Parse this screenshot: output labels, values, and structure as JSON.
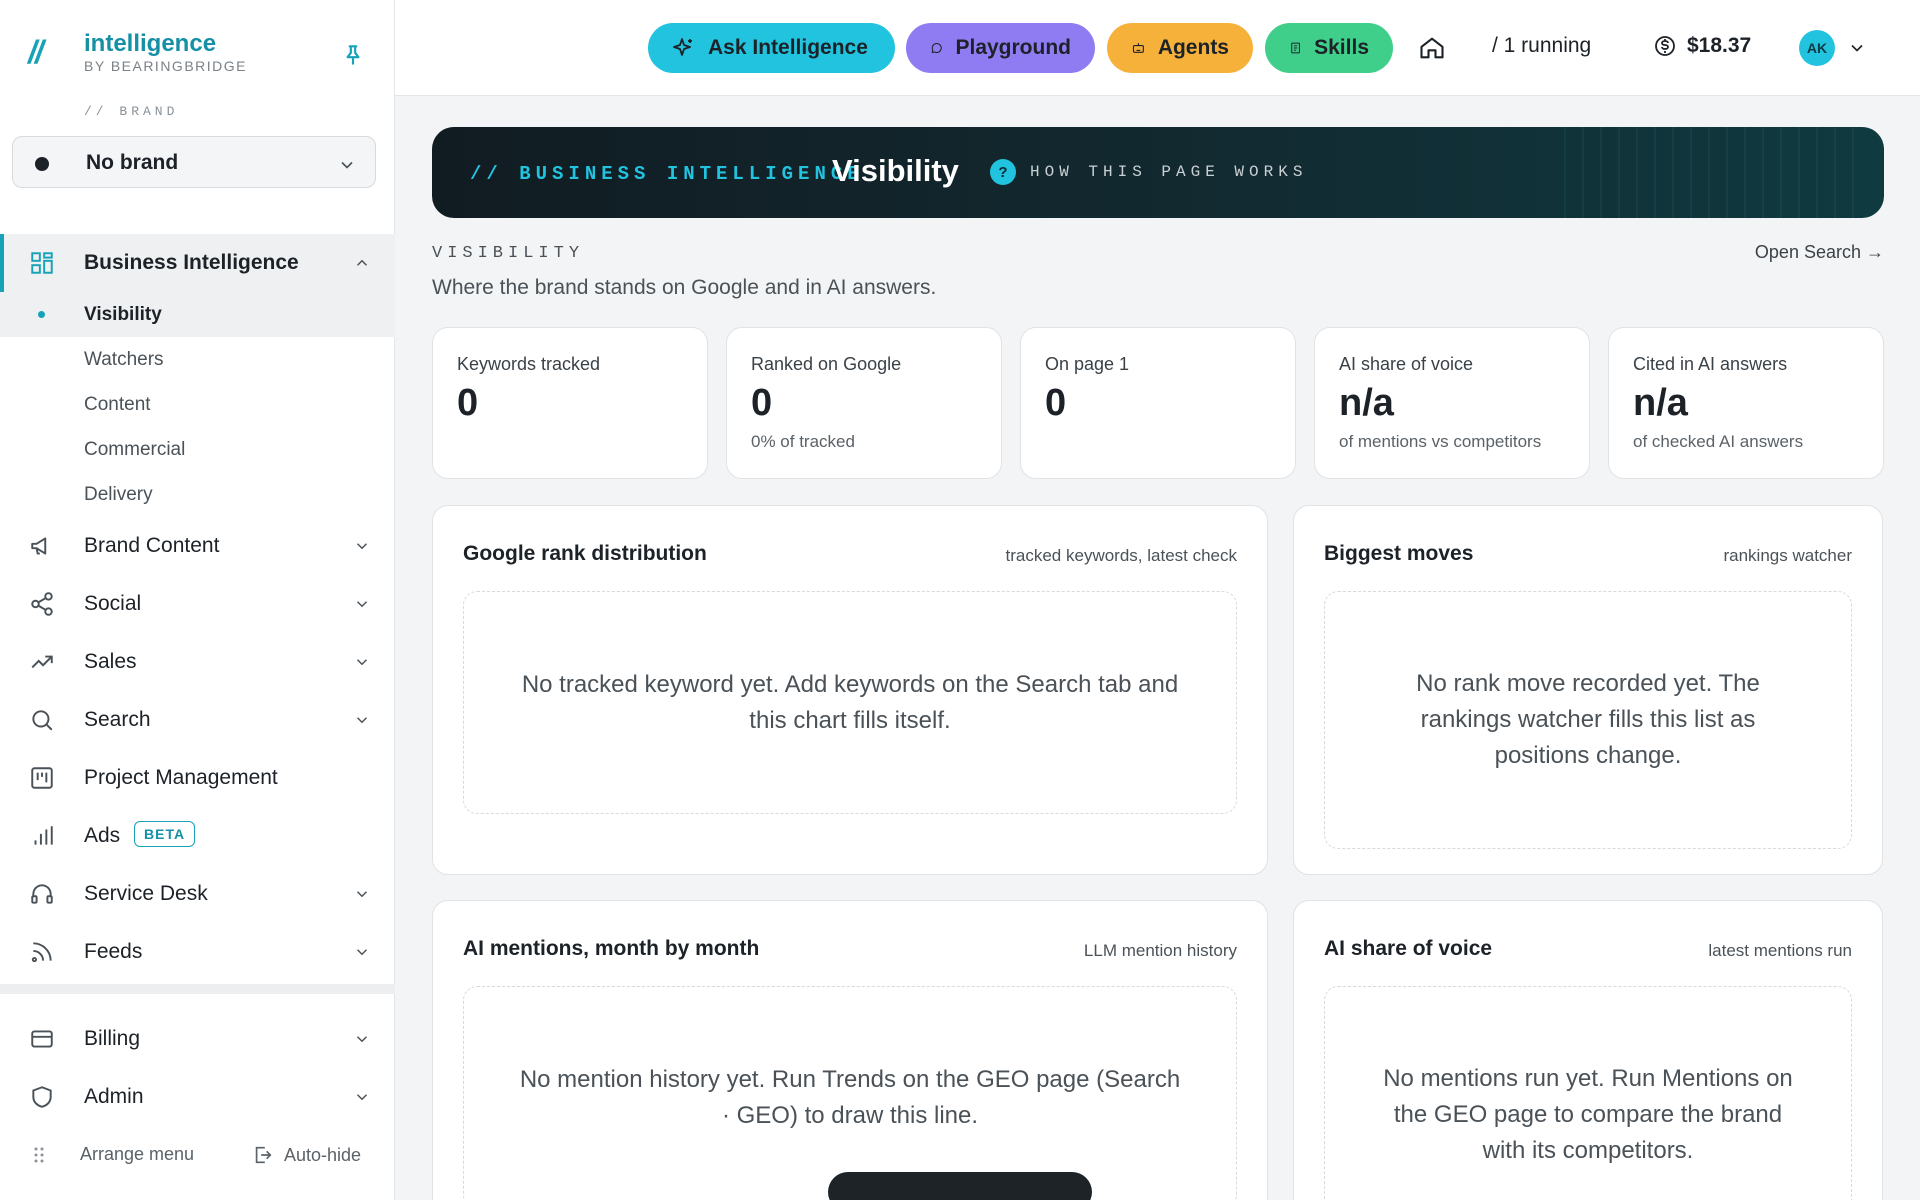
{
  "brand": {
    "name": "intelligence",
    "byline": "BY BEARINGBRIDGE",
    "section_label": "// BRAND",
    "selected": "No brand"
  },
  "sidebar": {
    "groups": [
      {
        "label": "Business Intelligence",
        "icon": "dashboard-grid-icon",
        "expanded": true,
        "children": [
          "Visibility",
          "Watchers",
          "Content",
          "Commercial",
          "Delivery"
        ],
        "current": "Visibility"
      },
      {
        "label": "Brand Content",
        "icon": "megaphone-icon"
      },
      {
        "label": "Social",
        "icon": "share-icon"
      },
      {
        "label": "Sales",
        "icon": "trending-up-icon"
      },
      {
        "label": "Search",
        "icon": "search-icon"
      },
      {
        "label": "Project Management",
        "icon": "kanban-icon"
      },
      {
        "label": "Ads",
        "icon": "bar-chart-icon",
        "badge": "BETA"
      },
      {
        "label": "Service Desk",
        "icon": "headset-icon"
      },
      {
        "label": "Feeds",
        "icon": "rss-icon"
      }
    ],
    "bottom": [
      {
        "label": "Billing",
        "icon": "credit-card-icon"
      },
      {
        "label": "Admin",
        "icon": "shield-icon"
      }
    ],
    "footer": {
      "arrange": "Arrange menu",
      "autohide": "Auto-hide"
    }
  },
  "topbar": {
    "ask": "Ask Intelligence",
    "playground": "Playground",
    "agents": "Agents",
    "skills": "Skills",
    "running": "/  1 running",
    "cost": "$18.37",
    "avatar": "AK",
    "colors": {
      "ask": "#22c3df",
      "playground": "#8f7cf2",
      "agents": "#f5b13a",
      "skills": "#3fcf8b"
    }
  },
  "hero": {
    "kicker": "// BUSINESS INTELLIGENCE",
    "title": "Visibility",
    "help": "HOW THIS PAGE WORKS"
  },
  "section": {
    "label": "VISIBILITY",
    "description": "Where the brand stands on Google and in AI answers.",
    "link": "Open Search →"
  },
  "stats": [
    {
      "label": "Keywords tracked",
      "value": "0",
      "sub": ""
    },
    {
      "label": "Ranked on Google",
      "value": "0",
      "sub": "0% of tracked"
    },
    {
      "label": "On page 1",
      "value": "0",
      "sub": ""
    },
    {
      "label": "AI share of voice",
      "value": "n/a",
      "sub": "of mentions vs competitors"
    },
    {
      "label": "Cited in AI answers",
      "value": "n/a",
      "sub": "of checked AI answers"
    }
  ],
  "panels": {
    "rank": {
      "title": "Google rank distribution",
      "meta": "tracked keywords, latest check",
      "empty": "No tracked keyword yet. Add keywords on the Search tab and this chart fills itself."
    },
    "moves": {
      "title": "Biggest moves",
      "meta": "rankings watcher",
      "empty": "No rank move recorded yet. The rankings watcher fills this list as positions change."
    },
    "mentions": {
      "title": "AI mentions, month by month",
      "meta": "LLM mention history",
      "empty": "No mention history yet. Run Trends on the GEO page (Search · GEO) to draw this line."
    },
    "sov": {
      "title": "AI share of voice",
      "meta": "latest mentions run",
      "empty": "No mentions run yet. Run Mentions on the GEO page to compare the brand with its competitors."
    }
  },
  "accent": "#17a2b8"
}
